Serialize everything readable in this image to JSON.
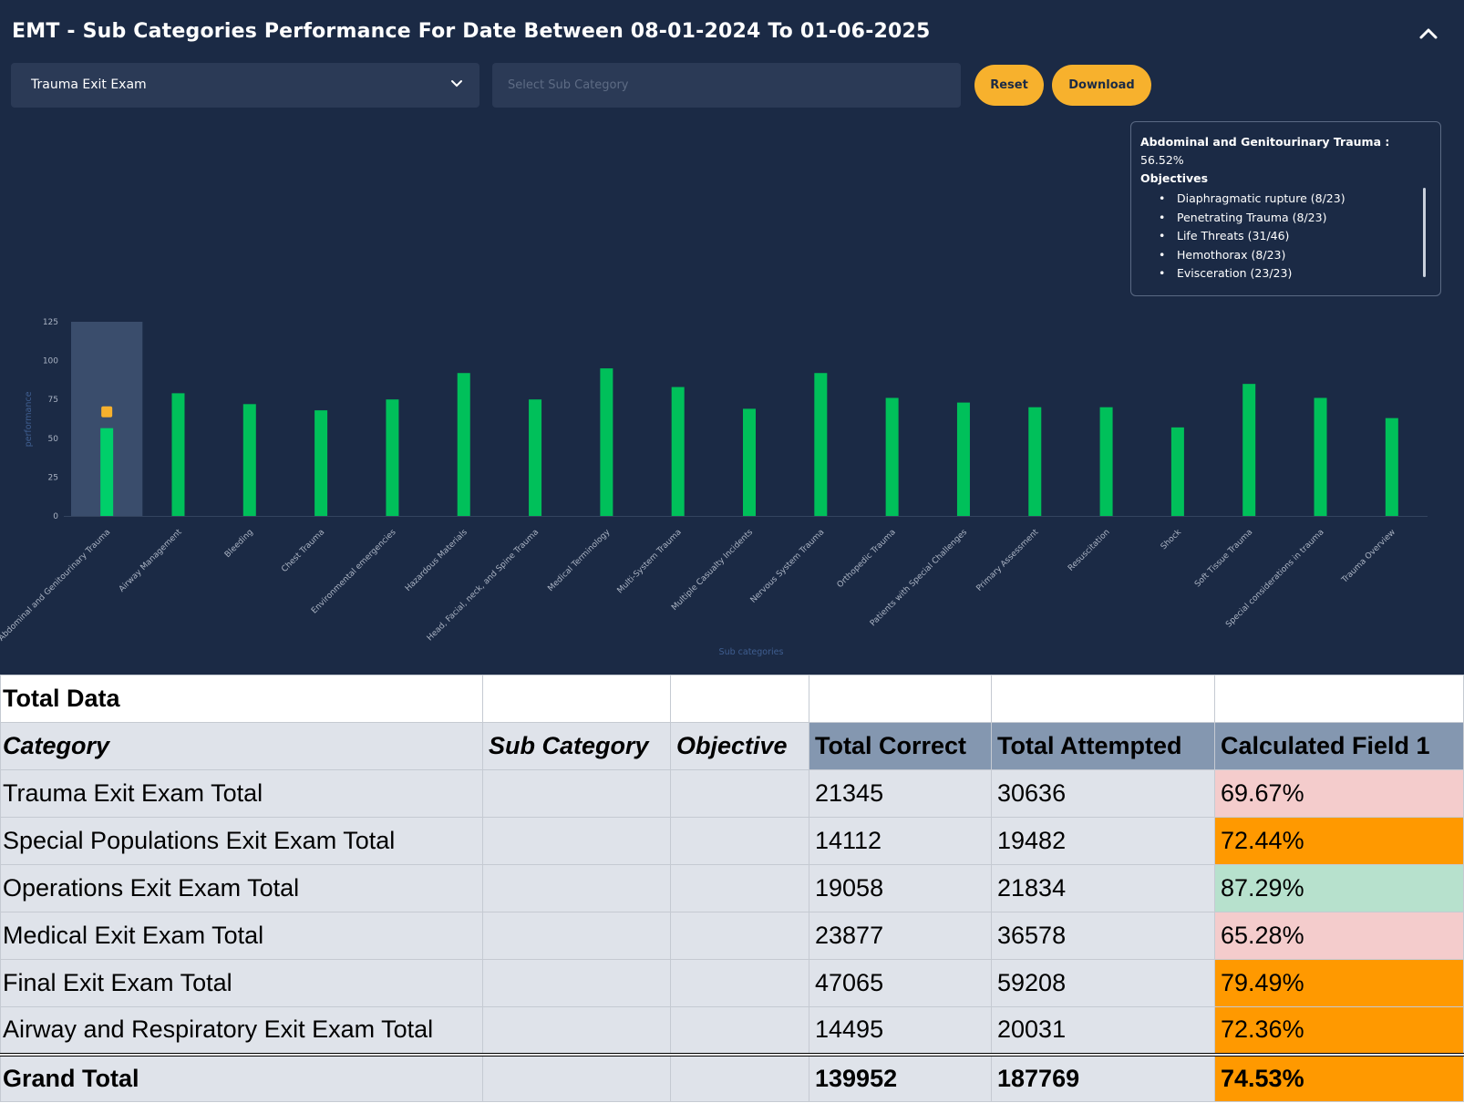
{
  "dashboard": {
    "title": "EMT - Sub Categories Performance For Date Between 08-01-2024 To 01-06-2025",
    "exam_select": {
      "value": "Trauma Exit Exam"
    },
    "sub_category_input": {
      "placeholder": "Select Sub Category",
      "value": ""
    },
    "reset_label": "Reset",
    "download_label": "Download",
    "icons": {
      "collapse": "chevron-up-icon",
      "dropdown": "chevron-down-icon"
    },
    "colors": {
      "background": "#1b2a45",
      "bar": "#00c05a",
      "highlight": "#3a4d6c",
      "accent": "#f7b12d"
    },
    "tooltip": {
      "heading": "Abdominal and Genitourinary Trauma :",
      "value": "56.52%",
      "objectives_label": "Objectives",
      "objectives": [
        "Diaphragmatic rupture (8/23)",
        "Penetrating Trauma (8/23)",
        "Life Threats (31/46)",
        "Hemothorax (8/23)",
        "Evisceration (23/23)"
      ]
    }
  },
  "chart_data": {
    "type": "bar",
    "ylabel": "performance",
    "xlabel": "Sub categories",
    "ylim": [
      0,
      125
    ],
    "yticks": [
      0,
      25,
      50,
      75,
      100,
      125
    ],
    "highlighted_category": "Abdominal and Genitourinary Trauma",
    "categories": [
      "Abdominal and Genitourinary Trauma",
      "Airway Management",
      "Bleeding",
      "Chest Trauma",
      "Environmental emergencies",
      "Hazardous Materials",
      "Head, Facial, neck, and Spine Trauma",
      "Medical Terminology",
      "Multi-System Trauma",
      "Multiple Casualty Incidents",
      "Nervous System Trauma",
      "Orthopedic Trauma",
      "Patients with Special Challenges",
      "Primary Assessment",
      "Resuscitation",
      "Shock",
      "Soft Tissue Trauma",
      "Special considerations in trauma",
      "Trauma Overview"
    ],
    "values": [
      56.52,
      79,
      72,
      68,
      75,
      92,
      75,
      95,
      83,
      69,
      92,
      76,
      73,
      70,
      70,
      57,
      85,
      76,
      63
    ]
  },
  "table": {
    "title": "Total Data",
    "headers": [
      "Category",
      "Sub Category",
      "Objective",
      "Total Correct",
      "Total Attempted",
      "Calculated Field 1"
    ],
    "rows": [
      {
        "category": "Trauma Exit Exam Total",
        "sub": "",
        "objective": "",
        "correct": "21345",
        "attempted": "30636",
        "calc": "69.67%",
        "calc_color": "#f4cccc"
      },
      {
        "category": "Special Populations Exit Exam Total",
        "sub": "",
        "objective": "",
        "correct": "14112",
        "attempted": "19482",
        "calc": "72.44%",
        "calc_color": "#ff9900"
      },
      {
        "category": "Operations Exit Exam Total",
        "sub": "",
        "objective": "",
        "correct": "19058",
        "attempted": "21834",
        "calc": "87.29%",
        "calc_color": "#b7e1cd"
      },
      {
        "category": "Medical Exit Exam Total",
        "sub": "",
        "objective": "",
        "correct": "23877",
        "attempted": "36578",
        "calc": "65.28%",
        "calc_color": "#f4cccc"
      },
      {
        "category": "Final Exit Exam Total",
        "sub": "",
        "objective": "",
        "correct": "47065",
        "attempted": "59208",
        "calc": "79.49%",
        "calc_color": "#ff9900"
      },
      {
        "category": "Airway and Respiratory Exit Exam Total",
        "sub": "",
        "objective": "",
        "correct": "14495",
        "attempted": "20031",
        "calc": "72.36%",
        "calc_color": "#ff9900"
      }
    ],
    "grand_total": {
      "label": "Grand Total",
      "correct": "139952",
      "attempted": "187769",
      "calc": "74.53%",
      "calc_color": "#ff9900"
    }
  }
}
